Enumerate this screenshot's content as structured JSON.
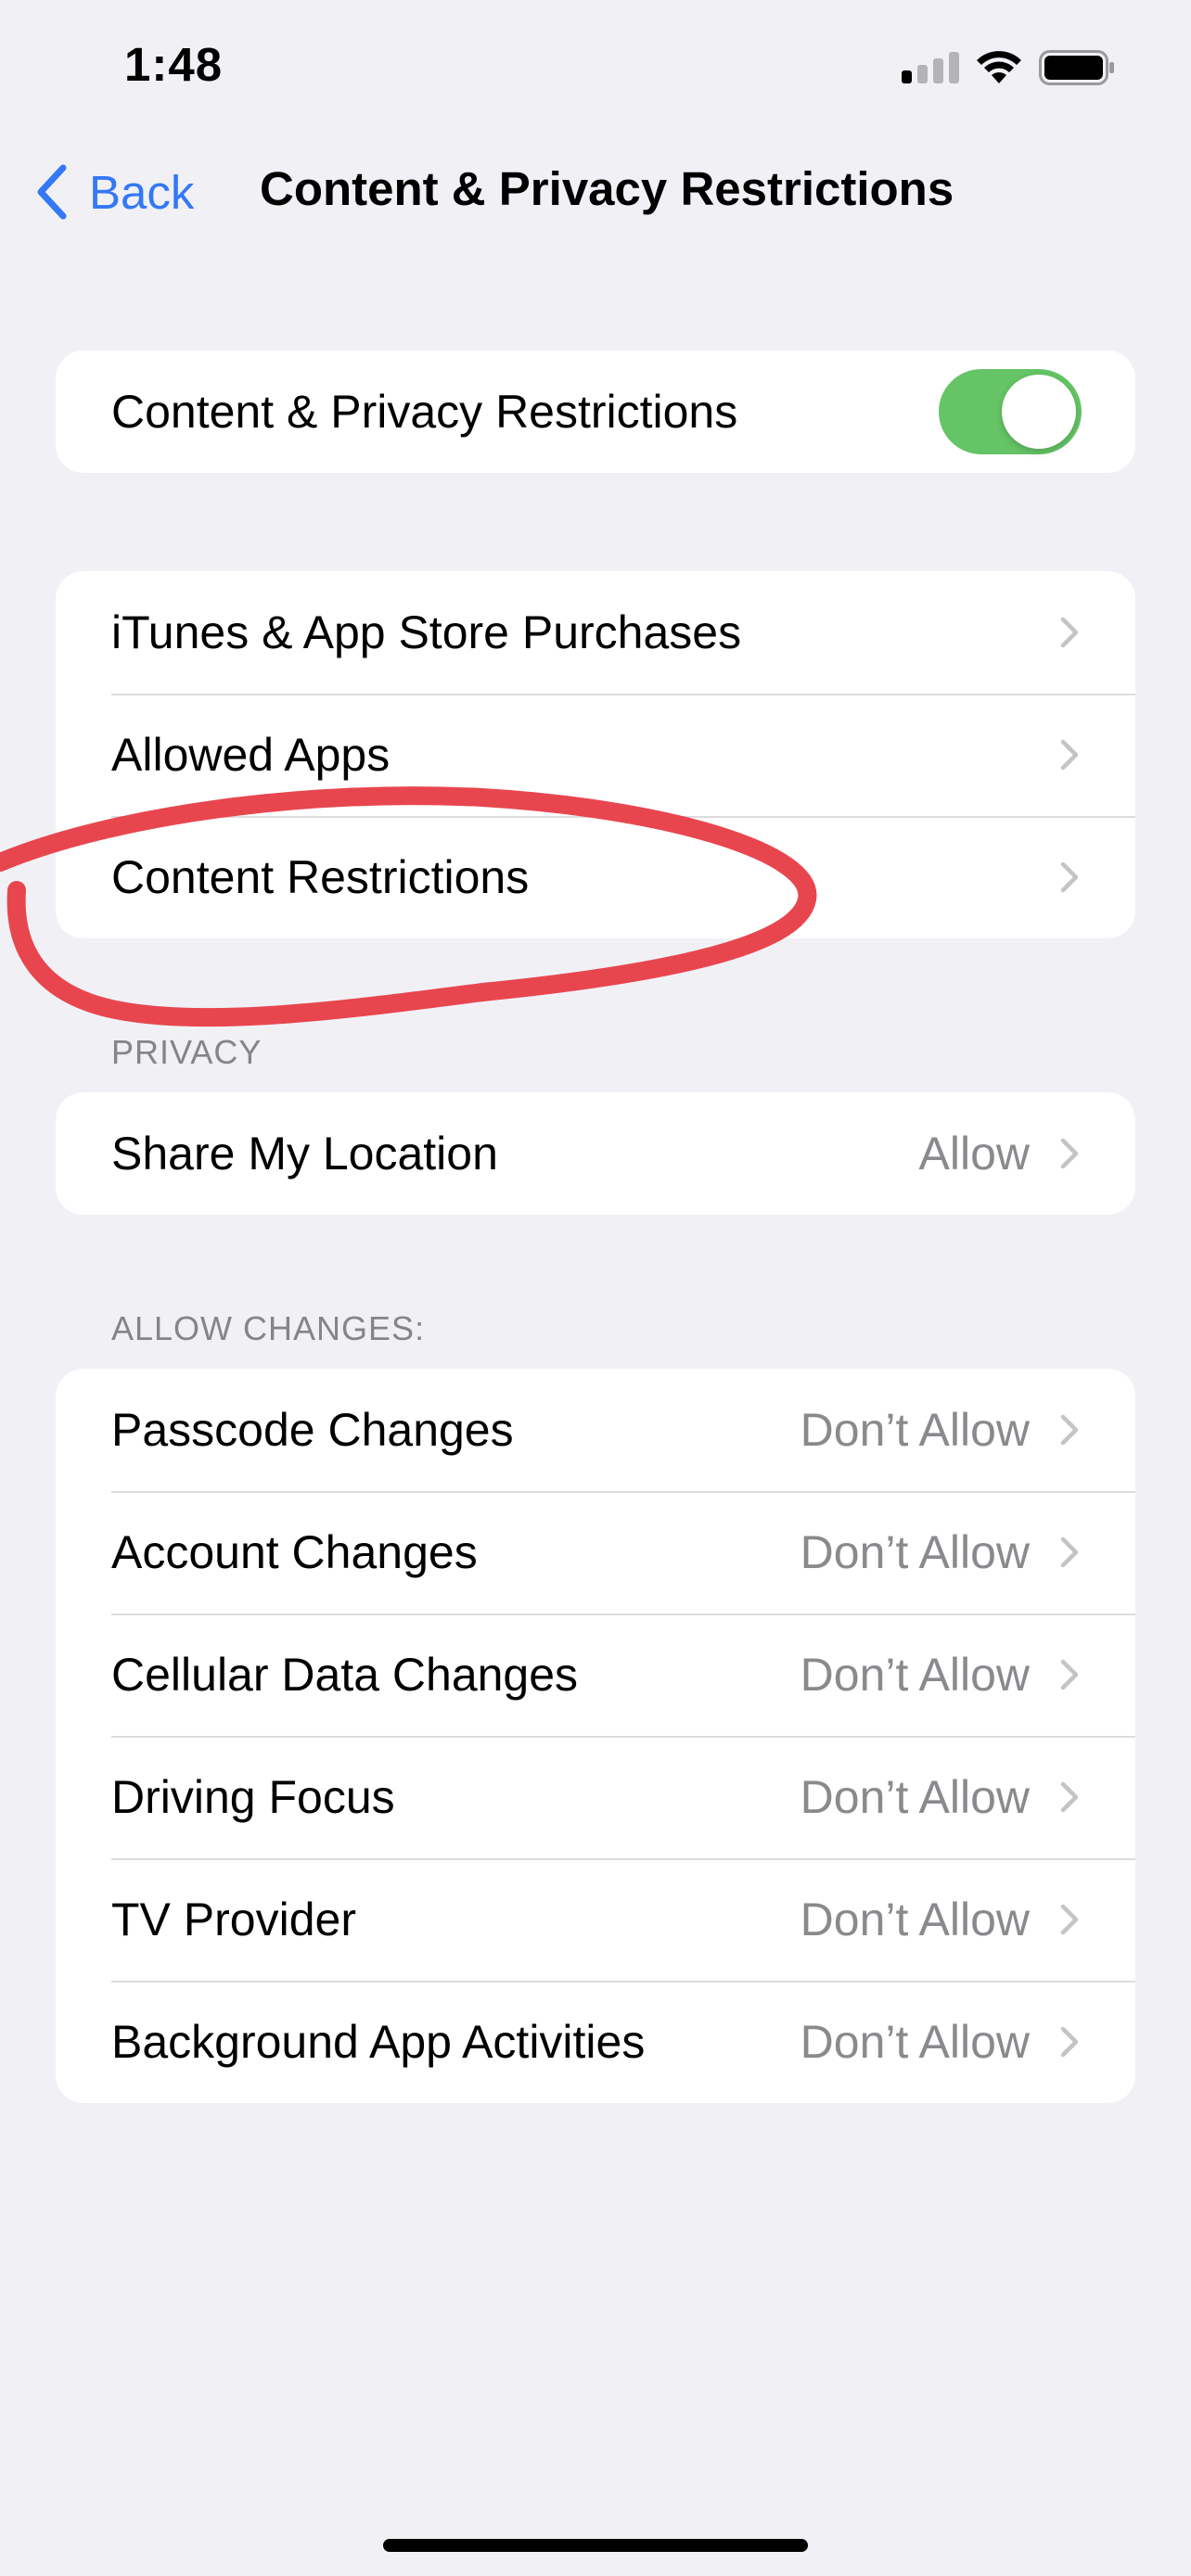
{
  "status_bar": {
    "time": "1:48"
  },
  "nav": {
    "back_label": "Back",
    "title": "Content & Privacy Restrictions"
  },
  "main_toggle": {
    "label": "Content & Privacy Restrictions",
    "on": true
  },
  "group1": {
    "items": [
      {
        "label": "iTunes & App Store Purchases"
      },
      {
        "label": "Allowed Apps"
      },
      {
        "label": "Content Restrictions"
      }
    ]
  },
  "privacy": {
    "header": "PRIVACY",
    "items": [
      {
        "label": "Share My Location",
        "value": "Allow"
      }
    ]
  },
  "allow_changes": {
    "header": "ALLOW CHANGES:",
    "items": [
      {
        "label": "Passcode Changes",
        "value": "Don’t Allow"
      },
      {
        "label": "Account Changes",
        "value": "Don’t Allow"
      },
      {
        "label": "Cellular Data Changes",
        "value": "Don’t Allow"
      },
      {
        "label": "Driving Focus",
        "value": "Don’t Allow"
      },
      {
        "label": "TV Provider",
        "value": "Don’t Allow"
      },
      {
        "label": "Background App Activities",
        "value": "Don’t Allow"
      }
    ]
  },
  "colors": {
    "accent": "#3478f6",
    "toggle_on": "#65c466",
    "annotation": "#e8464f",
    "background": "#f1f1f5"
  }
}
